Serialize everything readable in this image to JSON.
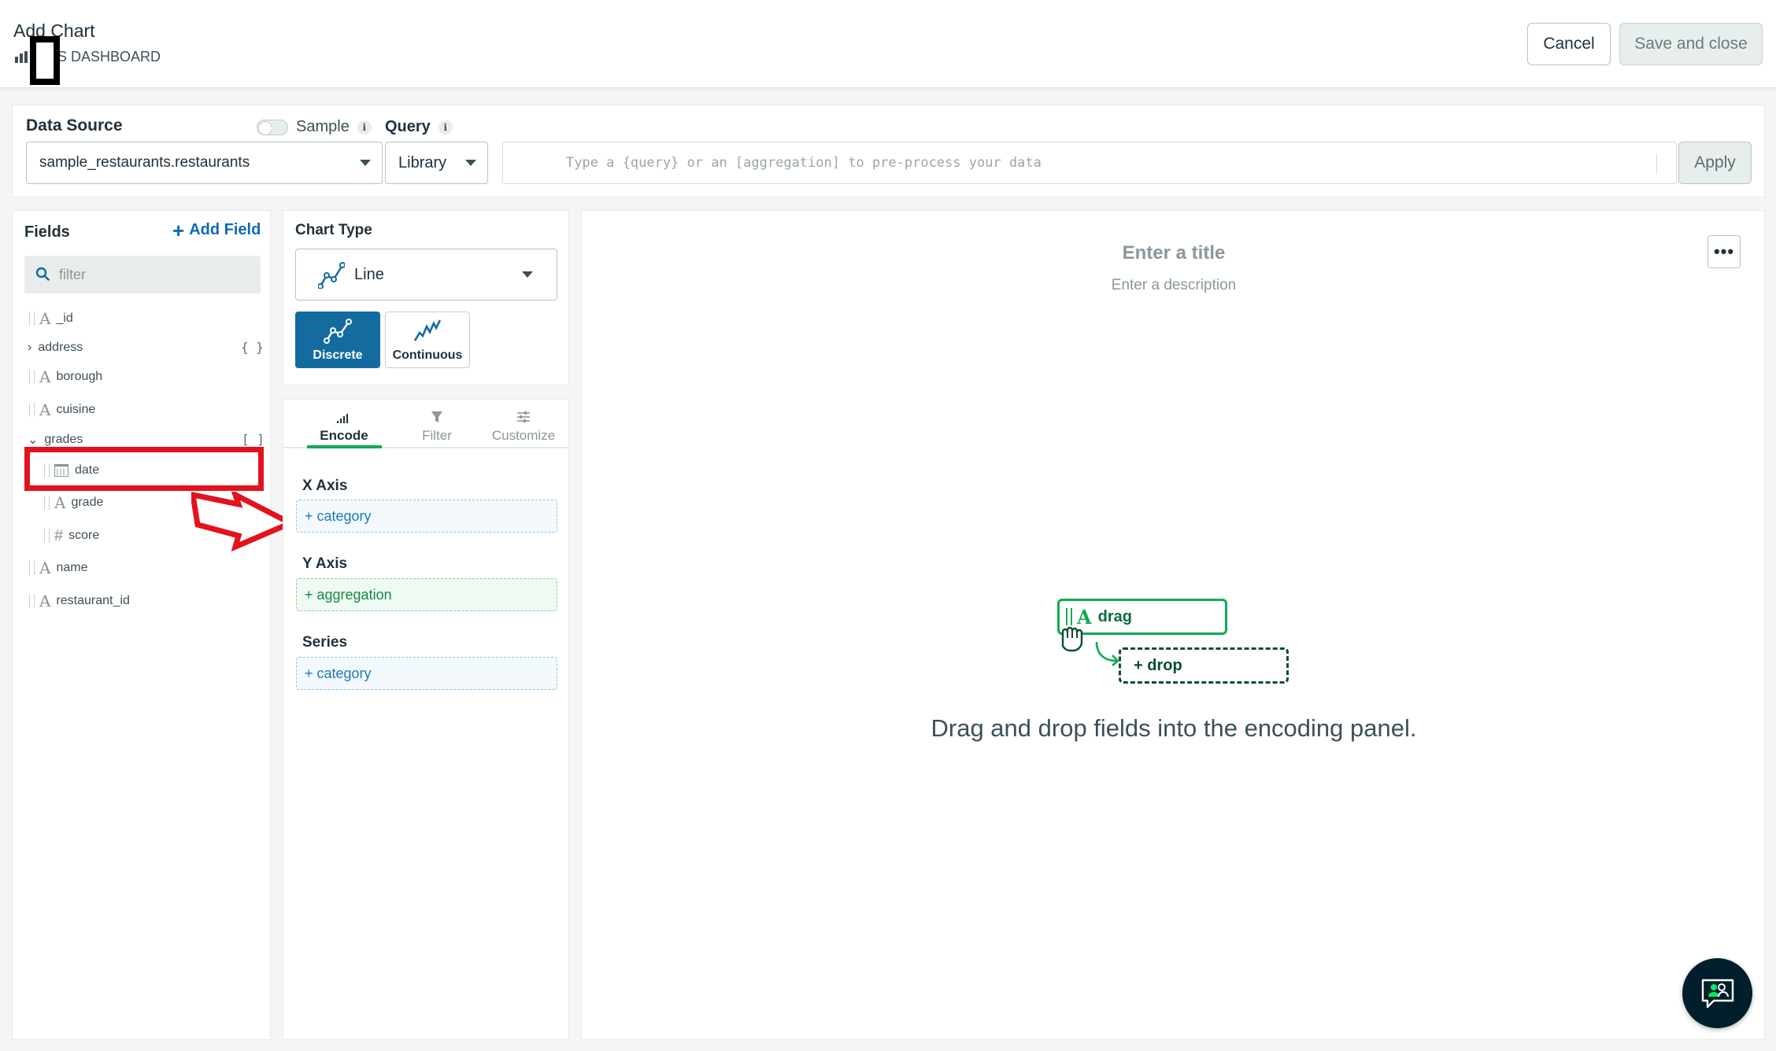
{
  "header": {
    "title": "Add Chart",
    "breadcrumb": "S DASHBOARD",
    "cancel_label": "Cancel",
    "save_label": "Save and close"
  },
  "datasource": {
    "label": "Data Source",
    "sample_label": "Sample",
    "query_label": "Query",
    "selected": "sample_restaurants.restaurants",
    "library_label": "Library",
    "query_placeholder": "Type a {query} or an [aggregation] to pre-process your data",
    "apply_label": "Apply"
  },
  "fields": {
    "title": "Fields",
    "add_label": "Add Field",
    "filter_placeholder": "filter",
    "items": [
      {
        "name": "_id",
        "type": "string"
      },
      {
        "name": "address",
        "type": "object",
        "meta": "{ }"
      },
      {
        "name": "borough",
        "type": "string"
      },
      {
        "name": "cuisine",
        "type": "string"
      },
      {
        "name": "grades",
        "type": "array",
        "meta": "[ ]"
      },
      {
        "name": "date",
        "type": "date"
      },
      {
        "name": "grade",
        "type": "string"
      },
      {
        "name": "score",
        "type": "number"
      },
      {
        "name": "name",
        "type": "string"
      },
      {
        "name": "restaurant_id",
        "type": "string"
      }
    ]
  },
  "chart_type": {
    "title": "Chart Type",
    "selected": "Line",
    "variants": [
      "Discrete",
      "Continuous"
    ],
    "active_variant": "Discrete"
  },
  "encode": {
    "tabs": [
      "Encode",
      "Filter",
      "Customize"
    ],
    "active_tab": "Encode",
    "x_axis_label": "X Axis",
    "x_axis_drop": "+ category",
    "y_axis_label": "Y Axis",
    "y_axis_drop": "+ aggregation",
    "series_label": "Series",
    "series_drop": "+ category"
  },
  "canvas": {
    "title_placeholder": "Enter a title",
    "description_placeholder": "Enter a description",
    "more_label": "•••",
    "drag_label": "drag",
    "drop_label": "+ drop",
    "message": "Drag and drop fields into the encoding panel."
  },
  "colors": {
    "accent_green": "#13aa52",
    "accent_blue": "#136ba0",
    "annotation_red": "#e3121c"
  }
}
